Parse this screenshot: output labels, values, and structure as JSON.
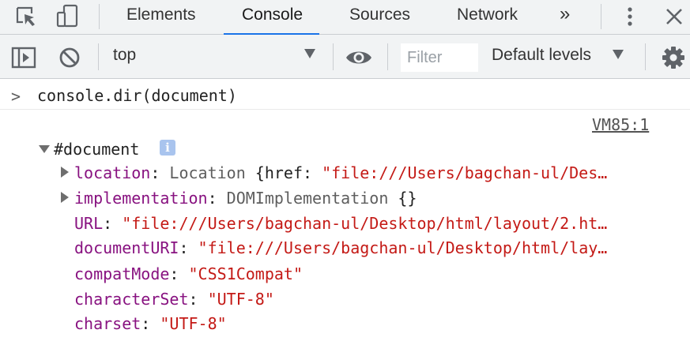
{
  "tabs": [
    {
      "label": "Elements"
    },
    {
      "label": "Console",
      "active": true
    },
    {
      "label": "Sources"
    },
    {
      "label": "Network"
    }
  ],
  "more_tabs_glyph": "»",
  "toolbar": {
    "context": "top",
    "filter_placeholder": "Filter",
    "levels": "Default levels"
  },
  "console": {
    "prompt": ">",
    "command": "console.dir(document)",
    "source_link": "VM85:1",
    "root_label": "#document",
    "info_glyph": "i",
    "properties": [
      {
        "key": "location",
        "sep": ": ",
        "type": "Location",
        "rest": " {href: ",
        "value": "\"file:///Users/bagchan-ul/Des…"
      },
      {
        "key": "implementation",
        "sep": ": ",
        "type": "DOMImplementation",
        "rest": " {}",
        "value": ""
      },
      {
        "key": "URL",
        "sep": ": ",
        "type": "",
        "rest": "",
        "value": "\"file:///Users/bagchan-ul/Desktop/html/layout/2.ht…"
      },
      {
        "key": "documentURI",
        "sep": ": ",
        "type": "",
        "rest": "",
        "value": "\"file:///Users/bagchan-ul/Desktop/html/lay…"
      },
      {
        "key": "compatMode",
        "sep": ": ",
        "type": "",
        "rest": "",
        "value": "\"CSS1Compat\""
      },
      {
        "key": "characterSet",
        "sep": ": ",
        "type": "",
        "rest": "",
        "value": "\"UTF-8\""
      },
      {
        "key": "charset",
        "sep": ": ",
        "type": "",
        "rest": "",
        "value": "\"UTF-8\""
      }
    ]
  }
}
